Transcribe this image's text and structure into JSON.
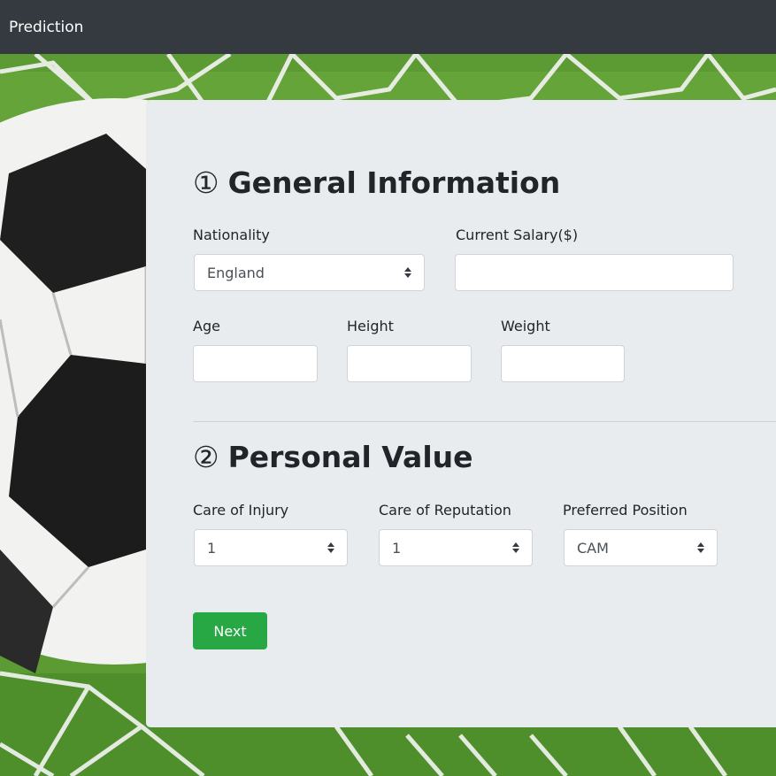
{
  "navbar": {
    "brand": "Prediction"
  },
  "general": {
    "number": "①",
    "title": "General Information",
    "nationality": {
      "label": "Nationality",
      "value": "England"
    },
    "salary": {
      "label": "Current Salary($)",
      "value": ""
    },
    "age": {
      "label": "Age",
      "value": ""
    },
    "height": {
      "label": "Height",
      "value": ""
    },
    "weight": {
      "label": "Weight",
      "value": ""
    }
  },
  "personal": {
    "number": "②",
    "title": "Personal Value",
    "injury": {
      "label": "Care of Injury",
      "value": "1"
    },
    "reputation": {
      "label": "Care of Reputation",
      "value": "1"
    },
    "position": {
      "label": "Preferred Position",
      "value": "CAM"
    }
  },
  "actions": {
    "next_label": "Next"
  },
  "colors": {
    "navbar": "#343a40",
    "card": "#e9ecef",
    "button": "#28a745"
  }
}
